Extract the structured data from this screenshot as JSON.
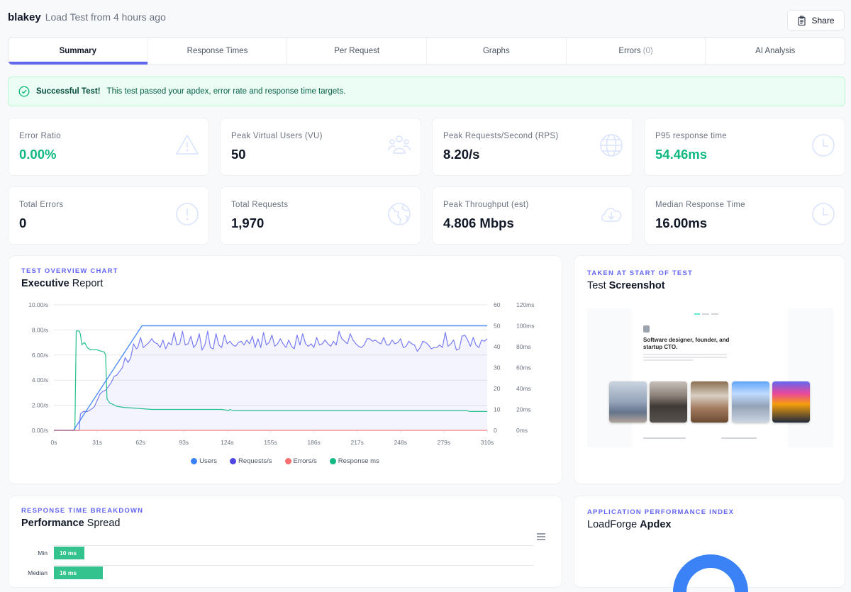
{
  "header": {
    "project": "blakey",
    "subtitle": "Load Test from 4 hours ago",
    "share_label": "Share"
  },
  "tabs": [
    {
      "label": "Summary",
      "active": true
    },
    {
      "label": "Response Times"
    },
    {
      "label": "Per Request"
    },
    {
      "label": "Graphs"
    },
    {
      "label": "Errors",
      "count": "(0)"
    },
    {
      "label": "AI Analysis"
    }
  ],
  "alert": {
    "title": "Successful Test!",
    "message": "This test passed your apdex, error rate and response time targets."
  },
  "stats": [
    {
      "label": "Error Ratio",
      "value": "0.00%",
      "icon": "warning-icon",
      "highlight": true
    },
    {
      "label": "Peak Virtual Users (VU)",
      "value": "50",
      "icon": "users-icon"
    },
    {
      "label": "Peak Requests/Second (RPS)",
      "value": "8.20/s",
      "icon": "globe-icon"
    },
    {
      "label": "P95 response time",
      "value": "54.46ms",
      "icon": "clock-icon",
      "highlight": true
    },
    {
      "label": "Total Errors",
      "value": "0",
      "icon": "exclamation-circle-icon"
    },
    {
      "label": "Total Requests",
      "value": "1,970",
      "icon": "earth-icon"
    },
    {
      "label": "Peak Throughput (est)",
      "value": "4.806 Mbps",
      "icon": "cloud-download-icon"
    },
    {
      "label": "Median Response Time",
      "value": "16.00ms",
      "icon": "clock-icon"
    }
  ],
  "overview": {
    "eyebrow": "TEST OVERVIEW CHART",
    "title_bold": "Executive",
    "title_rest": " Report"
  },
  "screenshot_card": {
    "eyebrow": "TAKEN AT START OF TEST",
    "title_rest": "Test ",
    "title_bold": "Screenshot",
    "preview_heading_1": "Software designer, founder, and",
    "preview_heading_2": "startup CTO."
  },
  "spread": {
    "eyebrow": "RESPONSE TIME BREAKDOWN",
    "title_bold": "Performance",
    "title_rest": " Spread",
    "menu_icon": "hamburger-menu-icon"
  },
  "apdex": {
    "eyebrow": "APPLICATION PERFORMANCE INDEX",
    "title_rest": "LoadForge ",
    "title_bold": "Apdex"
  },
  "chart_data": [
    {
      "type": "line",
      "title": "Executive Report",
      "x_ticks": [
        "0s",
        "31s",
        "62s",
        "93s",
        "124s",
        "155s",
        "186s",
        "217s",
        "248s",
        "279s",
        "310s"
      ],
      "xlim": [
        0,
        310
      ],
      "y_left": {
        "label": "Requests/s",
        "ticks": [
          "0.00/s",
          "2.00/s",
          "4.00/s",
          "6.00/s",
          "8.00/s",
          "10.00/s"
        ],
        "range": [
          0,
          10
        ]
      },
      "y_right_users": {
        "ticks": [
          "0",
          "10",
          "20",
          "30",
          "40",
          "50",
          "60"
        ],
        "range": [
          0,
          60
        ]
      },
      "y_right_ms": {
        "ticks": [
          "0ms",
          "20ms",
          "40ms",
          "60ms",
          "80ms",
          "100ms",
          "120ms"
        ],
        "range": [
          0,
          120
        ]
      },
      "legend": [
        "Users",
        "Requests/s",
        "Errors/s",
        "Response ms"
      ],
      "legend_position": "bottom",
      "grid": true,
      "series": [
        {
          "name": "Users",
          "axis": "users",
          "color": "#3b82f6",
          "x": [
            0,
            14,
            63,
            310
          ],
          "values": [
            0,
            0,
            50,
            50
          ]
        },
        {
          "name": "Requests/s",
          "axis": "left",
          "color": "#6366f1",
          "fill": true,
          "x": [
            0,
            18,
            19,
            21,
            24,
            27,
            29,
            31,
            33,
            35,
            37,
            39,
            41,
            43,
            45,
            47,
            49,
            51,
            53,
            55,
            57,
            59,
            60,
            62,
            64,
            66,
            68,
            70,
            72,
            74,
            76,
            78,
            80,
            82,
            84,
            86,
            88,
            90,
            92,
            94,
            96,
            98,
            100,
            102,
            104,
            106,
            108,
            110,
            112,
            114,
            116,
            118,
            120,
            122,
            124,
            126,
            128,
            130,
            132,
            134,
            136,
            138,
            140,
            142,
            144,
            146,
            148,
            150,
            152,
            154,
            156,
            158,
            160,
            162,
            164,
            166,
            168,
            170,
            172,
            174,
            176,
            178,
            180,
            182,
            184,
            186,
            188,
            190,
            192,
            194,
            196,
            198,
            200,
            202,
            204,
            206,
            208,
            210,
            212,
            214,
            216,
            218,
            220,
            222,
            224,
            226,
            228,
            230,
            232,
            234,
            236,
            238,
            240,
            242,
            244,
            246,
            248,
            250,
            252,
            254,
            256,
            258,
            260,
            262,
            264,
            266,
            268,
            270,
            272,
            274,
            276,
            278,
            280,
            282,
            284,
            286,
            288,
            290,
            292,
            294,
            296,
            298,
            300,
            302,
            304,
            306,
            308,
            310
          ],
          "values": [
            0,
            0,
            1.3,
            1.5,
            1.5,
            1.7,
            1.9,
            2.4,
            2.9,
            3.1,
            3.2,
            3.5,
            3.8,
            4.3,
            4.4,
            4.7,
            5.0,
            5.8,
            5.4,
            5.8,
            6.9,
            6.5,
            6.6,
            7.4,
            6.6,
            6.8,
            7.0,
            7.3,
            7.0,
            6.9,
            6.6,
            7.2,
            6.5,
            7.0,
            6.8,
            7.8,
            6.8,
            6.9,
            7.9,
            6.8,
            6.9,
            7.5,
            6.6,
            6.9,
            7.7,
            6.4,
            6.8,
            7.9,
            6.6,
            6.5,
            7.7,
            6.8,
            6.6,
            7.6,
            6.9,
            7.1,
            6.8,
            6.7,
            7.0,
            7.1,
            6.8,
            7.2,
            6.9,
            7.5,
            6.6,
            7.3,
            6.6,
            7.8,
            6.8,
            7.0,
            7.6,
            6.7,
            6.9,
            7.3,
            6.9,
            6.6,
            7.2,
            6.7,
            6.5,
            7.6,
            6.8,
            7.7,
            6.9,
            6.7,
            6.9,
            6.6,
            7.4,
            6.8,
            6.9,
            7.2,
            6.9,
            6.7,
            7.1,
            6.8,
            7.9,
            7.3,
            7.1,
            6.9,
            7.7,
            7.2,
            6.9,
            6.7,
            6.6,
            6.8,
            7.3,
            7.3,
            7.1,
            7.2,
            7.0,
            6.9,
            7.4,
            6.8,
            6.8,
            7.2,
            6.9,
            7.0,
            7.3,
            6.6,
            6.7,
            7.1,
            6.9,
            6.8,
            6.3,
            6.6,
            7.1,
            7.0,
            6.8,
            6.5,
            6.6,
            6.6,
            6.8,
            6.6,
            7.8,
            6.7,
            6.9,
            7.2,
            6.4,
            6.5,
            7.5,
            7.6,
            7.2,
            6.7,
            7.4,
            6.8,
            6.6,
            7.2,
            7.1,
            7.3,
            6.8
          ]
        },
        {
          "name": "Errors/s",
          "axis": "left",
          "color": "#f87171",
          "x": [
            0,
            310
          ],
          "values": [
            0,
            0
          ]
        },
        {
          "name": "Response ms",
          "axis": "ms",
          "color": "#10b981",
          "x": [
            0,
            15,
            16,
            18,
            19,
            20,
            22,
            24,
            26,
            28,
            31,
            33,
            36,
            37,
            38,
            39,
            40,
            42,
            45,
            50,
            60,
            70,
            80,
            120,
            125,
            126,
            128,
            140,
            295,
            298,
            310
          ],
          "values": [
            0,
            0,
            95,
            95,
            92,
            82,
            84,
            79,
            77,
            77,
            77,
            76,
            75,
            72,
            30,
            28,
            26,
            25,
            23,
            22,
            21,
            20,
            20,
            20,
            19,
            20,
            19,
            19,
            19,
            18,
            18
          ]
        }
      ]
    },
    {
      "type": "bar",
      "title": "Performance Spread",
      "orientation": "horizontal",
      "categories": [
        "Min",
        "Median"
      ],
      "values": [
        10,
        16
      ],
      "value_labels": [
        "10 ms",
        "16 ms"
      ],
      "unit": "ms",
      "color": "#34c38f"
    },
    {
      "type": "pie",
      "title": "LoadForge Apdex",
      "color": "#3b82f6"
    }
  ]
}
